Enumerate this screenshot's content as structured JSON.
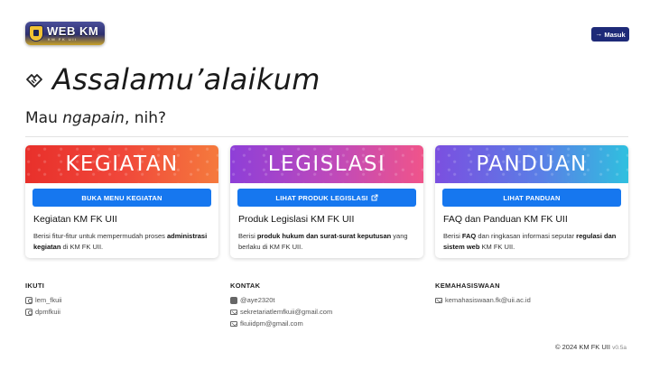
{
  "header": {
    "logo_text": "WEB KM",
    "logo_sub": "KM FK UII",
    "login_label": "Masuk",
    "login_icon": "sign-in-icon"
  },
  "hero": {
    "greeting": "Assalamu’alaikum",
    "greeting_icon": "handshake-icon",
    "subtitle_prefix": "Mau ",
    "subtitle_emph": "ngapain",
    "subtitle_suffix": ", nih?"
  },
  "cards": [
    {
      "banner": "KEGIATAN",
      "button": "BUKA MENU KEGIATAN",
      "title": "Kegiatan KM FK UII",
      "desc_parts": [
        "Berisi fitur-fitur untuk mempermudah proses ",
        "administrasi kegiatan",
        " di KM FK UII."
      ]
    },
    {
      "banner": "LEGISLASI",
      "button": "LIHAT PRODUK LEGISLASI",
      "button_icon": "external-link-icon",
      "title": "Produk Legislasi KM FK UII",
      "desc_parts": [
        "Berisi ",
        "produk hukum dan surat-surat keputusan",
        " yang berlaku di KM FK UII."
      ]
    },
    {
      "banner": "PANDUAN",
      "button": "LIHAT PANDUAN",
      "title": "FAQ dan Panduan KM FK UII",
      "desc_parts": [
        "Berisi ",
        "FAQ",
        " dan ringkasan informasi seputar ",
        "regulasi dan sistem web",
        " KM FK UII."
      ]
    }
  ],
  "footer": {
    "ikuti": {
      "heading": "IKUTI",
      "items": [
        "lem_fkuii",
        "dpmfkuii"
      ]
    },
    "kontak": {
      "heading": "KONTAK",
      "items": [
        "@aye2320t",
        "sekretariatlemfkuii@gmail.com",
        "fkuiidpm@gmail.com"
      ]
    },
    "kemahasiswaan": {
      "heading": "KEMAHASISWAAN",
      "items": [
        "kemahasiswaan.fk@uii.ac.id"
      ]
    },
    "copyright": "© 2024 KM FK UII",
    "version": "v0.5a"
  },
  "colors": {
    "primary": "#1677ef",
    "navy": "#1e2a78",
    "kegiatan": "#e8302b",
    "legislasi": "#c04ab9",
    "panduan": "#5a7fe6"
  }
}
